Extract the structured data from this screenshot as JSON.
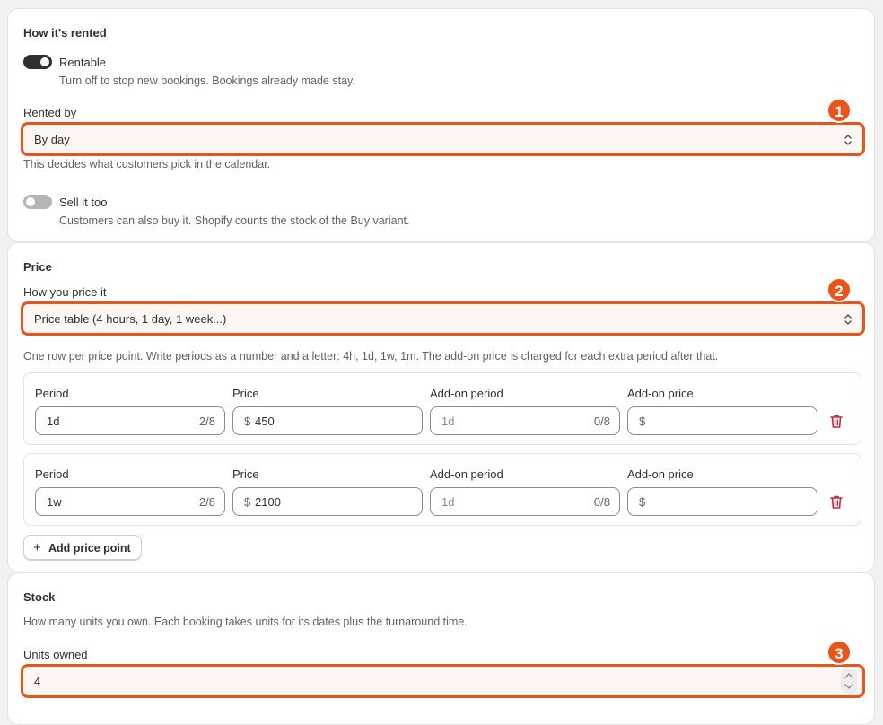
{
  "rental": {
    "heading": "How it's rented",
    "rentable": {
      "label": "Rentable",
      "help": "Turn off to stop new bookings. Bookings already made stay.",
      "on": true
    },
    "rented_by": {
      "label": "Rented by",
      "value": "By day",
      "help": "This decides what customers pick in the calendar."
    },
    "sell_it_too": {
      "label": "Sell it too",
      "help": "Customers can also buy it. Shopify counts the stock of the Buy variant.",
      "on": false
    }
  },
  "price": {
    "heading": "Price",
    "how_label": "How you price it",
    "how_value": "Price table (4 hours, 1 day, 1 week...)",
    "help": "One row per price point. Write periods as a number and a letter: 4h, 1d, 1w, 1m. The add-on price is charged for each extra period after that.",
    "columns": [
      "Period",
      "Price",
      "Add-on period",
      "Add-on price"
    ],
    "rows": [
      {
        "period": "1d",
        "period_count": "2/8",
        "currency": "$",
        "price": "450",
        "addon_period_placeholder": "1d",
        "addon_period_count": "0/8",
        "addon_price": ""
      },
      {
        "period": "1w",
        "period_count": "2/8",
        "currency": "$",
        "price": "2100",
        "addon_period_placeholder": "1d",
        "addon_period_count": "0/8",
        "addon_price": ""
      }
    ],
    "add_button": "Add price point"
  },
  "stock": {
    "heading": "Stock",
    "help": "How many units you own. Each booking takes units for its dates plus the turnaround time.",
    "units_label": "Units owned",
    "units_value": "4"
  },
  "badges": [
    "1",
    "2",
    "3"
  ],
  "colors": {
    "highlight": "#e8541a",
    "delete": "#c5283d",
    "toggle_on": "#303030",
    "toggle_off": "#b5b5b5"
  },
  "icons": {
    "select_chevron": "chevron-up-down-icon",
    "delete": "trash-icon",
    "add": "plus-icon",
    "number_stepper": "stepper-icon"
  }
}
